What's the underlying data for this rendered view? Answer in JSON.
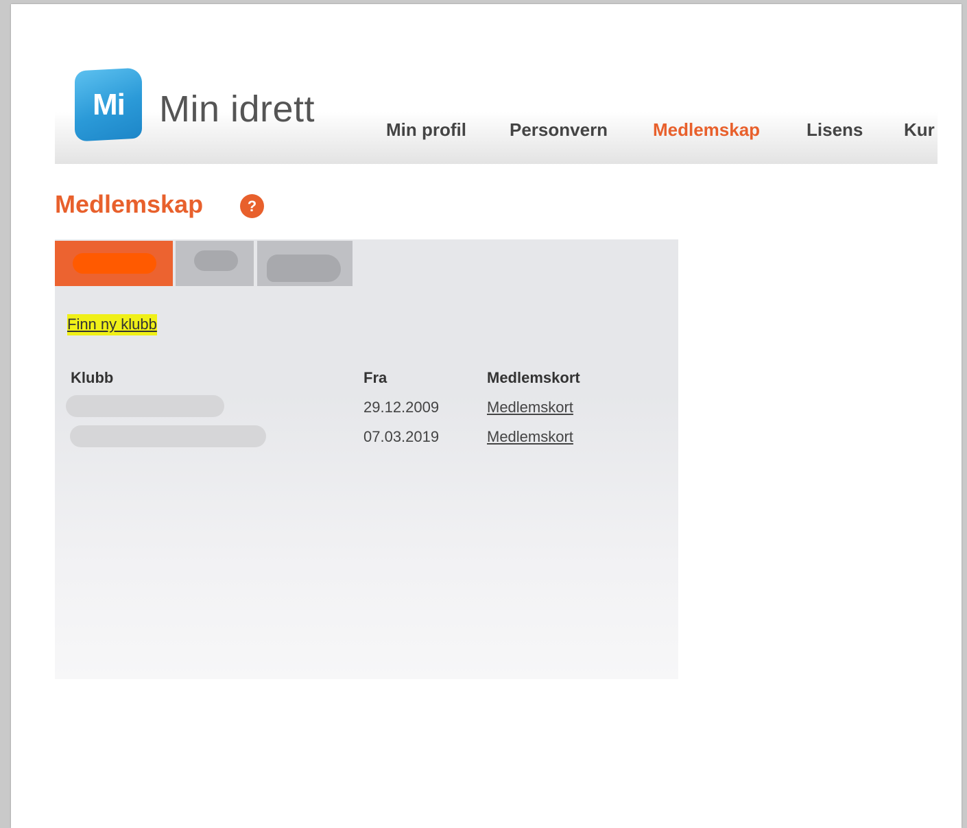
{
  "header": {
    "logo_badge_text": "Mi",
    "logo_text": "Min idrett",
    "nav": [
      {
        "label": "Min profil",
        "active": false
      },
      {
        "label": "Personvern",
        "active": false
      },
      {
        "label": "Medlemskap",
        "active": true
      },
      {
        "label": "Lisens",
        "active": false
      },
      {
        "label": "Kur",
        "active": false
      }
    ]
  },
  "page": {
    "title": "Medlemskap",
    "help_icon": "?"
  },
  "panel": {
    "tabs": [
      {
        "name": "tab-active",
        "redacted": true
      },
      {
        "name": "tab-second",
        "redacted": true
      },
      {
        "name": "tab-third",
        "redacted": true
      }
    ],
    "find_club_label": "Finn ny klubb",
    "table": {
      "columns": [
        "Klubb",
        "Fra",
        "Medlemskort"
      ],
      "rows": [
        {
          "club": "",
          "from": "29.12.2009",
          "card_link": "Medlemskort"
        },
        {
          "club": "",
          "from": "07.03.2019",
          "card_link": "Medlemskort"
        }
      ]
    }
  },
  "colors": {
    "accent": "#e8602c",
    "logo_blue": "#2b9ad8",
    "highlight": "#f0f018"
  }
}
